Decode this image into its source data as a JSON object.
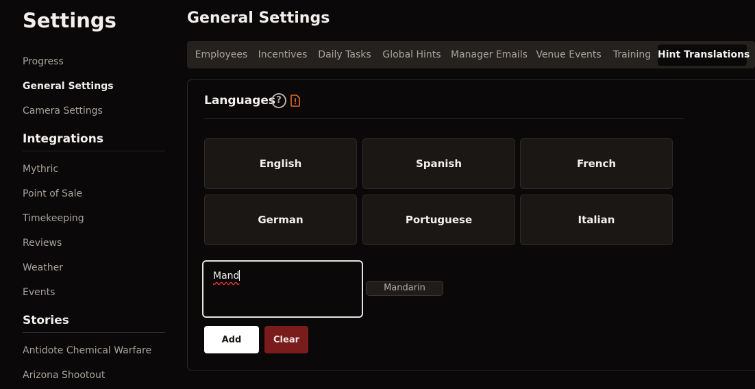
{
  "sidebar": {
    "title": "Settings",
    "items_top": [
      {
        "label": "Progress",
        "active": false
      },
      {
        "label": "General Settings",
        "active": true
      },
      {
        "label": "Camera Settings",
        "active": false
      }
    ],
    "integrations": {
      "heading": "Integrations",
      "items": [
        "Mythric",
        "Point of Sale",
        "Timekeeping",
        "Reviews",
        "Weather",
        "Events"
      ]
    },
    "stories": {
      "heading": "Stories",
      "items": [
        "Antidote Chemical Warfare",
        "Arizona Shootout"
      ]
    }
  },
  "main": {
    "title": "General Settings",
    "tabs": [
      {
        "label": "Employees",
        "active": false
      },
      {
        "label": "Incentives",
        "active": false
      },
      {
        "label": "Daily Tasks",
        "active": false
      },
      {
        "label": "Global Hints",
        "active": false
      },
      {
        "label": "Manager Emails",
        "active": false
      },
      {
        "label": "Venue Events",
        "active": false
      },
      {
        "label": "Training",
        "active": false
      },
      {
        "label": "Hint Translations",
        "active": true
      }
    ],
    "languages": {
      "heading": "Languages",
      "help_icon": "?",
      "warning_icon_color": "#e8692a",
      "cards": [
        "English",
        "Spanish",
        "French",
        "German",
        "Portuguese",
        "Italian"
      ],
      "input_value": "Mand",
      "suggestion": "Mandarin",
      "add_label": "Add",
      "clear_label": "Clear"
    }
  },
  "colors": {
    "background": "#0a0808",
    "card": "#1a1715",
    "danger": "#7a1c1c",
    "accent_warning": "#e8692a"
  }
}
